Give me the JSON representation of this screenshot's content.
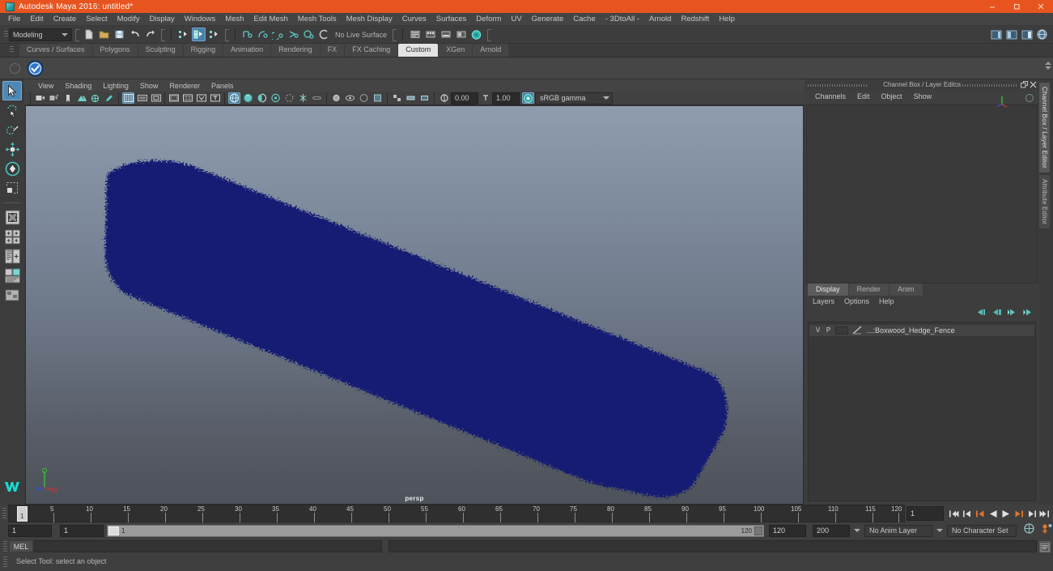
{
  "window": {
    "title": "Autodesk Maya 2016: untitled*",
    "icon": "maya-logo-icon",
    "minimize": "–",
    "maximize": "❐",
    "close": "✕"
  },
  "menubar": {
    "items": [
      "File",
      "Edit",
      "Create",
      "Select",
      "Modify",
      "Display",
      "Windows",
      "Mesh",
      "Edit Mesh",
      "Mesh Tools",
      "Mesh Display",
      "Curves",
      "Surfaces",
      "Deform",
      "UV",
      "Generate",
      "Cache",
      "- 3DtoAll -",
      "Arnold",
      "Redshift",
      "Help"
    ]
  },
  "statusline": {
    "mode": "Modeling",
    "live_surface": "No Live Surface",
    "snap_field_1": "0.00",
    "snap_field_2": "1.00",
    "color_space": "sRGB gamma",
    "icons": [
      "new-scene-icon",
      "open-scene-icon",
      "save-scene-icon",
      "undo-icon",
      "redo-icon",
      "select-by-hierarchy-icon",
      "select-by-object-icon",
      "select-by-component-icon",
      "snap-to-grid-icon",
      "snap-to-curve-icon",
      "snap-to-point-icon",
      "snap-to-projected-center-icon",
      "snap-to-view-plane-icon",
      "make-live-icon",
      "show-hide-editors-icon",
      "attribute-editor-icon",
      "tool-settings-icon",
      "channel-box-icon",
      "render-view-icon",
      "ipr-render-icon",
      "render-settings-icon"
    ]
  },
  "shelf": {
    "tabs": [
      "Curves / Surfaces",
      "Polygons",
      "Sculpting",
      "Rigging",
      "Animation",
      "Rendering",
      "FX",
      "FX Caching",
      "Custom",
      "XGen",
      "Arnold"
    ],
    "selected_tab": "Custom",
    "buttons": [
      "checkmark-shield-icon"
    ]
  },
  "toolbox": {
    "tools": [
      "select-tool",
      "lasso-select-tool",
      "paint-select-tool",
      "move-tool",
      "rotate-tool",
      "scale-tool",
      "last-tool-used",
      "single-perspective-view-layout",
      "four-view-layout",
      "persp-outliner-layout",
      "persp-graph-hypershade-layout",
      "persp-hypergraph-layout"
    ],
    "selected": "select-tool"
  },
  "viewport": {
    "menus": [
      "View",
      "Shading",
      "Lighting",
      "Show",
      "Renderer",
      "Panels"
    ],
    "camera_label": "persp",
    "toolbar_icons": [
      "select-camera-icon",
      "lock-camera-icon",
      "camera-attributes-icon",
      "bookmark-icon",
      "image-plane-icon",
      "two-dim-pan-zoom-icon",
      "grease-pencil-icon",
      "grid-icon",
      "film-gate-icon",
      "resolution-gate-icon",
      "gate-mask-icon",
      "field-chart-icon",
      "safe-action-icon",
      "safe-title-icon",
      "wireframe-icon",
      "smooth-shade-all-icon",
      "shaded-wireframe-icon",
      "textured-icon",
      "use-all-lights-icon",
      "shadows-icon",
      "ambient-occlusion-icon",
      "motion-blur-icon",
      "multisample-icon",
      "depth-of-field-icon",
      "isolate-select-icon",
      "xray-icon",
      "xray-joints-icon",
      "exposure-icon",
      "gamma-icon",
      "color-management-icon"
    ],
    "model": {
      "name": "Boxwood_Hedge_Fence",
      "color": "#121a73",
      "background_top": "#8e9cad",
      "background_bottom": "#4e525a"
    },
    "axis_gizmo": {
      "x": "x",
      "y": "y",
      "z": "z",
      "x_color": "#b53a3a",
      "y_color": "#3fb03f",
      "z_color": "#3a4fb5"
    }
  },
  "right_dock": {
    "panel_title": "Channel Box / Layer Editor",
    "undock_icon": "undock-icon",
    "close_icon": "close-icon",
    "vertical_tabs": [
      "Channel Box / Layer Editor",
      "Attribute Editor"
    ],
    "selected_vertical_tab": "Channel Box / Layer Editor",
    "channelbox_menus": [
      "Channels",
      "Edit",
      "Object",
      "Show"
    ],
    "layer_editor": {
      "tabs": [
        "Display",
        "Render",
        "Anim"
      ],
      "selected_tab": "Display",
      "menus": [
        "Layers",
        "Options",
        "Help"
      ],
      "toolbar_icons": [
        "new-layer-icon",
        "new-layer-from-selected-icon",
        "select-objects-in-layer-icon",
        "add-selected-objects-icon"
      ],
      "columns": [
        "V",
        "P"
      ],
      "layers": [
        {
          "visible": "V",
          "playback": "P",
          "name": "...:Boxwood_Hedge_Fence",
          "color": "#9a9a9a"
        }
      ]
    }
  },
  "timeline": {
    "current_frame": "1",
    "frame_field": "1",
    "ticks": [
      {
        "label": "1",
        "pos": 0
      },
      {
        "label": "5",
        "pos": 5
      },
      {
        "label": "10",
        "pos": 10
      },
      {
        "label": "15",
        "pos": 15
      },
      {
        "label": "20",
        "pos": 20
      },
      {
        "label": "25",
        "pos": 25
      },
      {
        "label": "30",
        "pos": 30
      },
      {
        "label": "35",
        "pos": 35
      },
      {
        "label": "40",
        "pos": 40
      },
      {
        "label": "45",
        "pos": 45
      },
      {
        "label": "50",
        "pos": 50
      },
      {
        "label": "55",
        "pos": 55
      },
      {
        "label": "60",
        "pos": 60
      },
      {
        "label": "65",
        "pos": 65
      },
      {
        "label": "70",
        "pos": 70
      },
      {
        "label": "75",
        "pos": 75
      },
      {
        "label": "80",
        "pos": 80
      },
      {
        "label": "85",
        "pos": 85
      },
      {
        "label": "90",
        "pos": 90
      },
      {
        "label": "95",
        "pos": 95
      },
      {
        "label": "100",
        "pos": 100
      },
      {
        "label": "105",
        "pos": 105
      },
      {
        "label": "110",
        "pos": 110
      },
      {
        "label": "115",
        "pos": 115
      },
      {
        "label": "120",
        "pos": 120
      }
    ],
    "playback_buttons": [
      "go-to-start-icon",
      "step-back-key-icon",
      "step-back-frame-icon",
      "play-backwards-icon",
      "play-forwards-icon",
      "step-forward-frame-icon",
      "step-forward-key-icon",
      "go-to-end-icon"
    ]
  },
  "range_slider": {
    "anim_start": "1",
    "range_start": "1",
    "range_bar_start": "1",
    "range_bar_end": "120",
    "range_end": "120",
    "anim_end": "200",
    "anim_layer": "No Anim Layer",
    "character_set": "No Character Set",
    "auto_key_icon": "auto-keyframe-icon",
    "anim_prefs_icon": "animation-preferences-icon"
  },
  "command_line": {
    "language": "MEL",
    "value": "",
    "placeholder": "",
    "script_editor_icon": "script-editor-icon"
  },
  "help_line": {
    "text": "Select Tool: select an object"
  }
}
